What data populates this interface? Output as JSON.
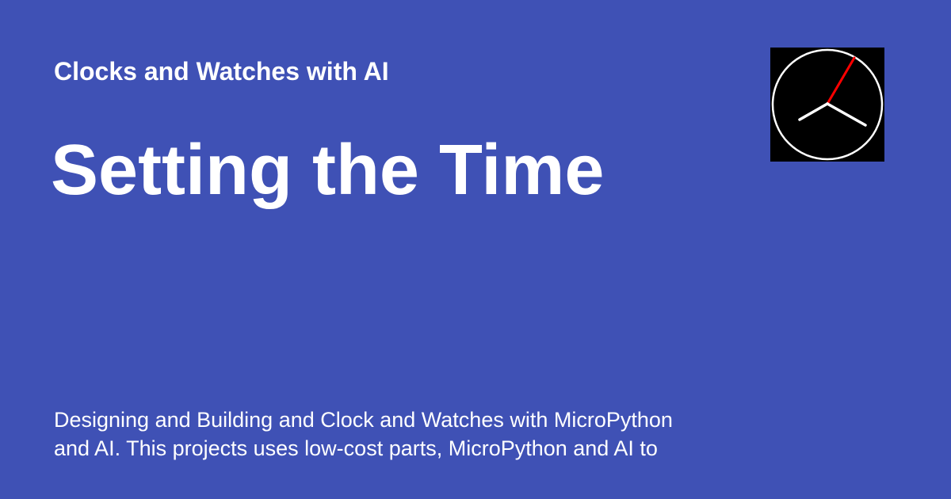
{
  "site": {
    "name": "Clocks and Watches with AI"
  },
  "page": {
    "title": "Setting the Time",
    "description_lines": [
      "Designing and Building and Clock and Watches with MicroPython",
      "and AI.  This projects uses low-cost parts, MicroPython and AI to"
    ]
  },
  "colors": {
    "background": "#3f51b5",
    "text": "#ffffff",
    "logo_background": "#000000",
    "second_hand": "#ff0000",
    "clock_hands": "#ffffff"
  },
  "logo": {
    "icon": "analog-clock-icon"
  }
}
